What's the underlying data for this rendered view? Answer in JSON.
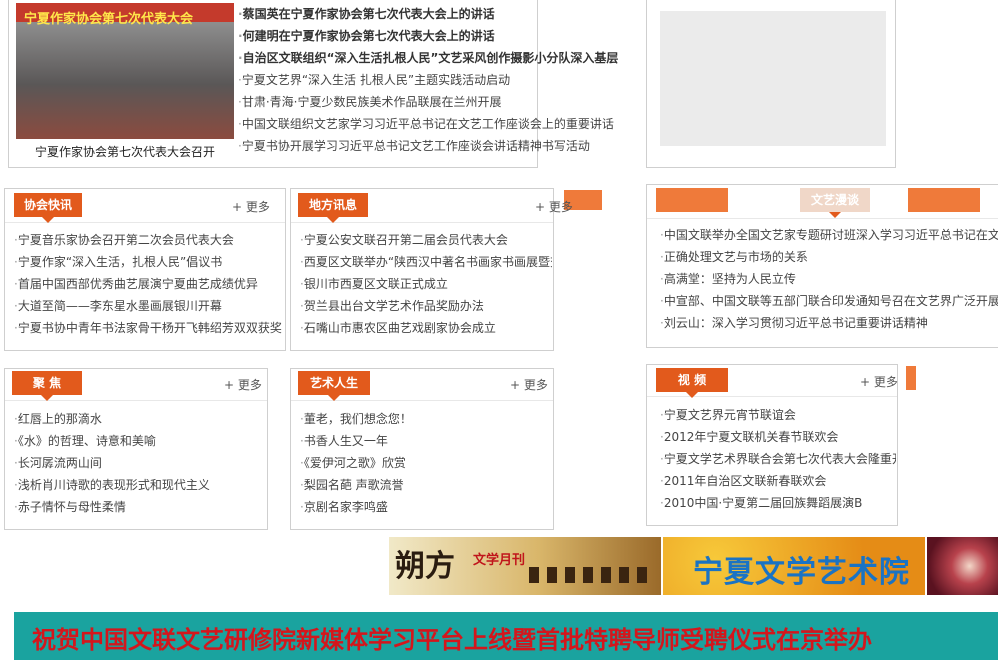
{
  "feature": {
    "photo_title": "宁夏作家协会第七次代表大会",
    "caption": "宁夏作家协会第七次代表大会召开",
    "headlines": [
      "蔡国英在宁夏作家协会第七次代表大会上的讲话",
      "何建明在宁夏作家协会第七次代表大会上的讲话",
      "自治区文联组织“深入生活扎根人民”文艺采风创作摄影小分队深入基层"
    ],
    "items": [
      "宁夏文艺界“深入生活 扎根人民”主题实践活动启动",
      "甘肃·青海·宁夏少数民族美术作品联展在兰州开展",
      "中国文联组织文艺家学习习近平总书记在文艺工作座谈会上的重要讲话",
      "宁夏书协开展学习习近平总书记文艺工作座谈会讲话精神书写活动"
    ]
  },
  "more_label": "+ 更多",
  "sections": {
    "xiehui": {
      "title": "协会快讯",
      "items": [
        "宁夏音乐家协会召开第二次会员代表大会",
        "宁夏作家“深入生活，扎根人民”倡议书",
        "首届中国西部优秀曲艺展演宁夏曲艺成绩优异",
        "大道至简——李东星水墨画展银川开幕",
        "宁夏书协中青年书法家骨干杨开飞韩绍芳双双获奖"
      ]
    },
    "difang": {
      "title": "地方讯息",
      "items": [
        "宁夏公安文联召开第二届会员代表大会",
        "西夏区文联举办“陕西汉中著名书画家书画展暨交流笔会”",
        "银川市西夏区文联正式成立",
        "贺兰县出台文学艺术作品奖励办法",
        "石嘴山市惠农区曲艺戏剧家协会成立"
      ]
    },
    "wenyi": {
      "title": "文艺漫谈",
      "items": [
        "中国文联举办全国文艺家专题研讨班深入学习习近平总书记在文艺",
        "正确处理文艺与市场的关系",
        "高满堂：坚持为人民立传",
        "中宣部、中国文联等五部门联合印发通知号召在文艺界广泛开展",
        "刘云山：深入学习贯彻习近平总书记重要讲话精神"
      ]
    },
    "jujiao": {
      "title": "聚 焦",
      "items": [
        "红唇上的那滴水",
        "《水》的哲理、诗意和美喻",
        "长河孱流两山间",
        "浅析肖川诗歌的表现形式和现代主义",
        "赤子情怀与母性柔情"
      ]
    },
    "yishu": {
      "title": "艺术人生",
      "items": [
        "董老，我们想念您！",
        "书香人生又一年",
        "《爱伊河之歌》欣赏",
        "梨园名葩 声歌流誉",
        "京剧名家李鸣盛"
      ]
    },
    "shipin": {
      "title": "视 频",
      "items": [
        "宁夏文艺界元宵节联谊会",
        "2012年宁夏文联机关春节联欢会",
        "宁夏文学艺术界联合会第七次代表大会隆重开幕",
        "2011年自治区文联新春联欢会",
        "2010中国·宁夏第二届回族舞蹈展演B"
      ]
    }
  },
  "banners": {
    "shuofang_big": "朔方",
    "shuofang_small": "文学月刊",
    "academy": "宁夏文学艺术院"
  },
  "marquee": "祝贺中国文联文艺研修院新媒体学习平台上线暨首批特聘导师受聘仪式在京举办",
  "colors": {
    "accent": "#e25a1c",
    "marquee_bg": "#1aa39f",
    "marquee_text": "#d4161c"
  }
}
